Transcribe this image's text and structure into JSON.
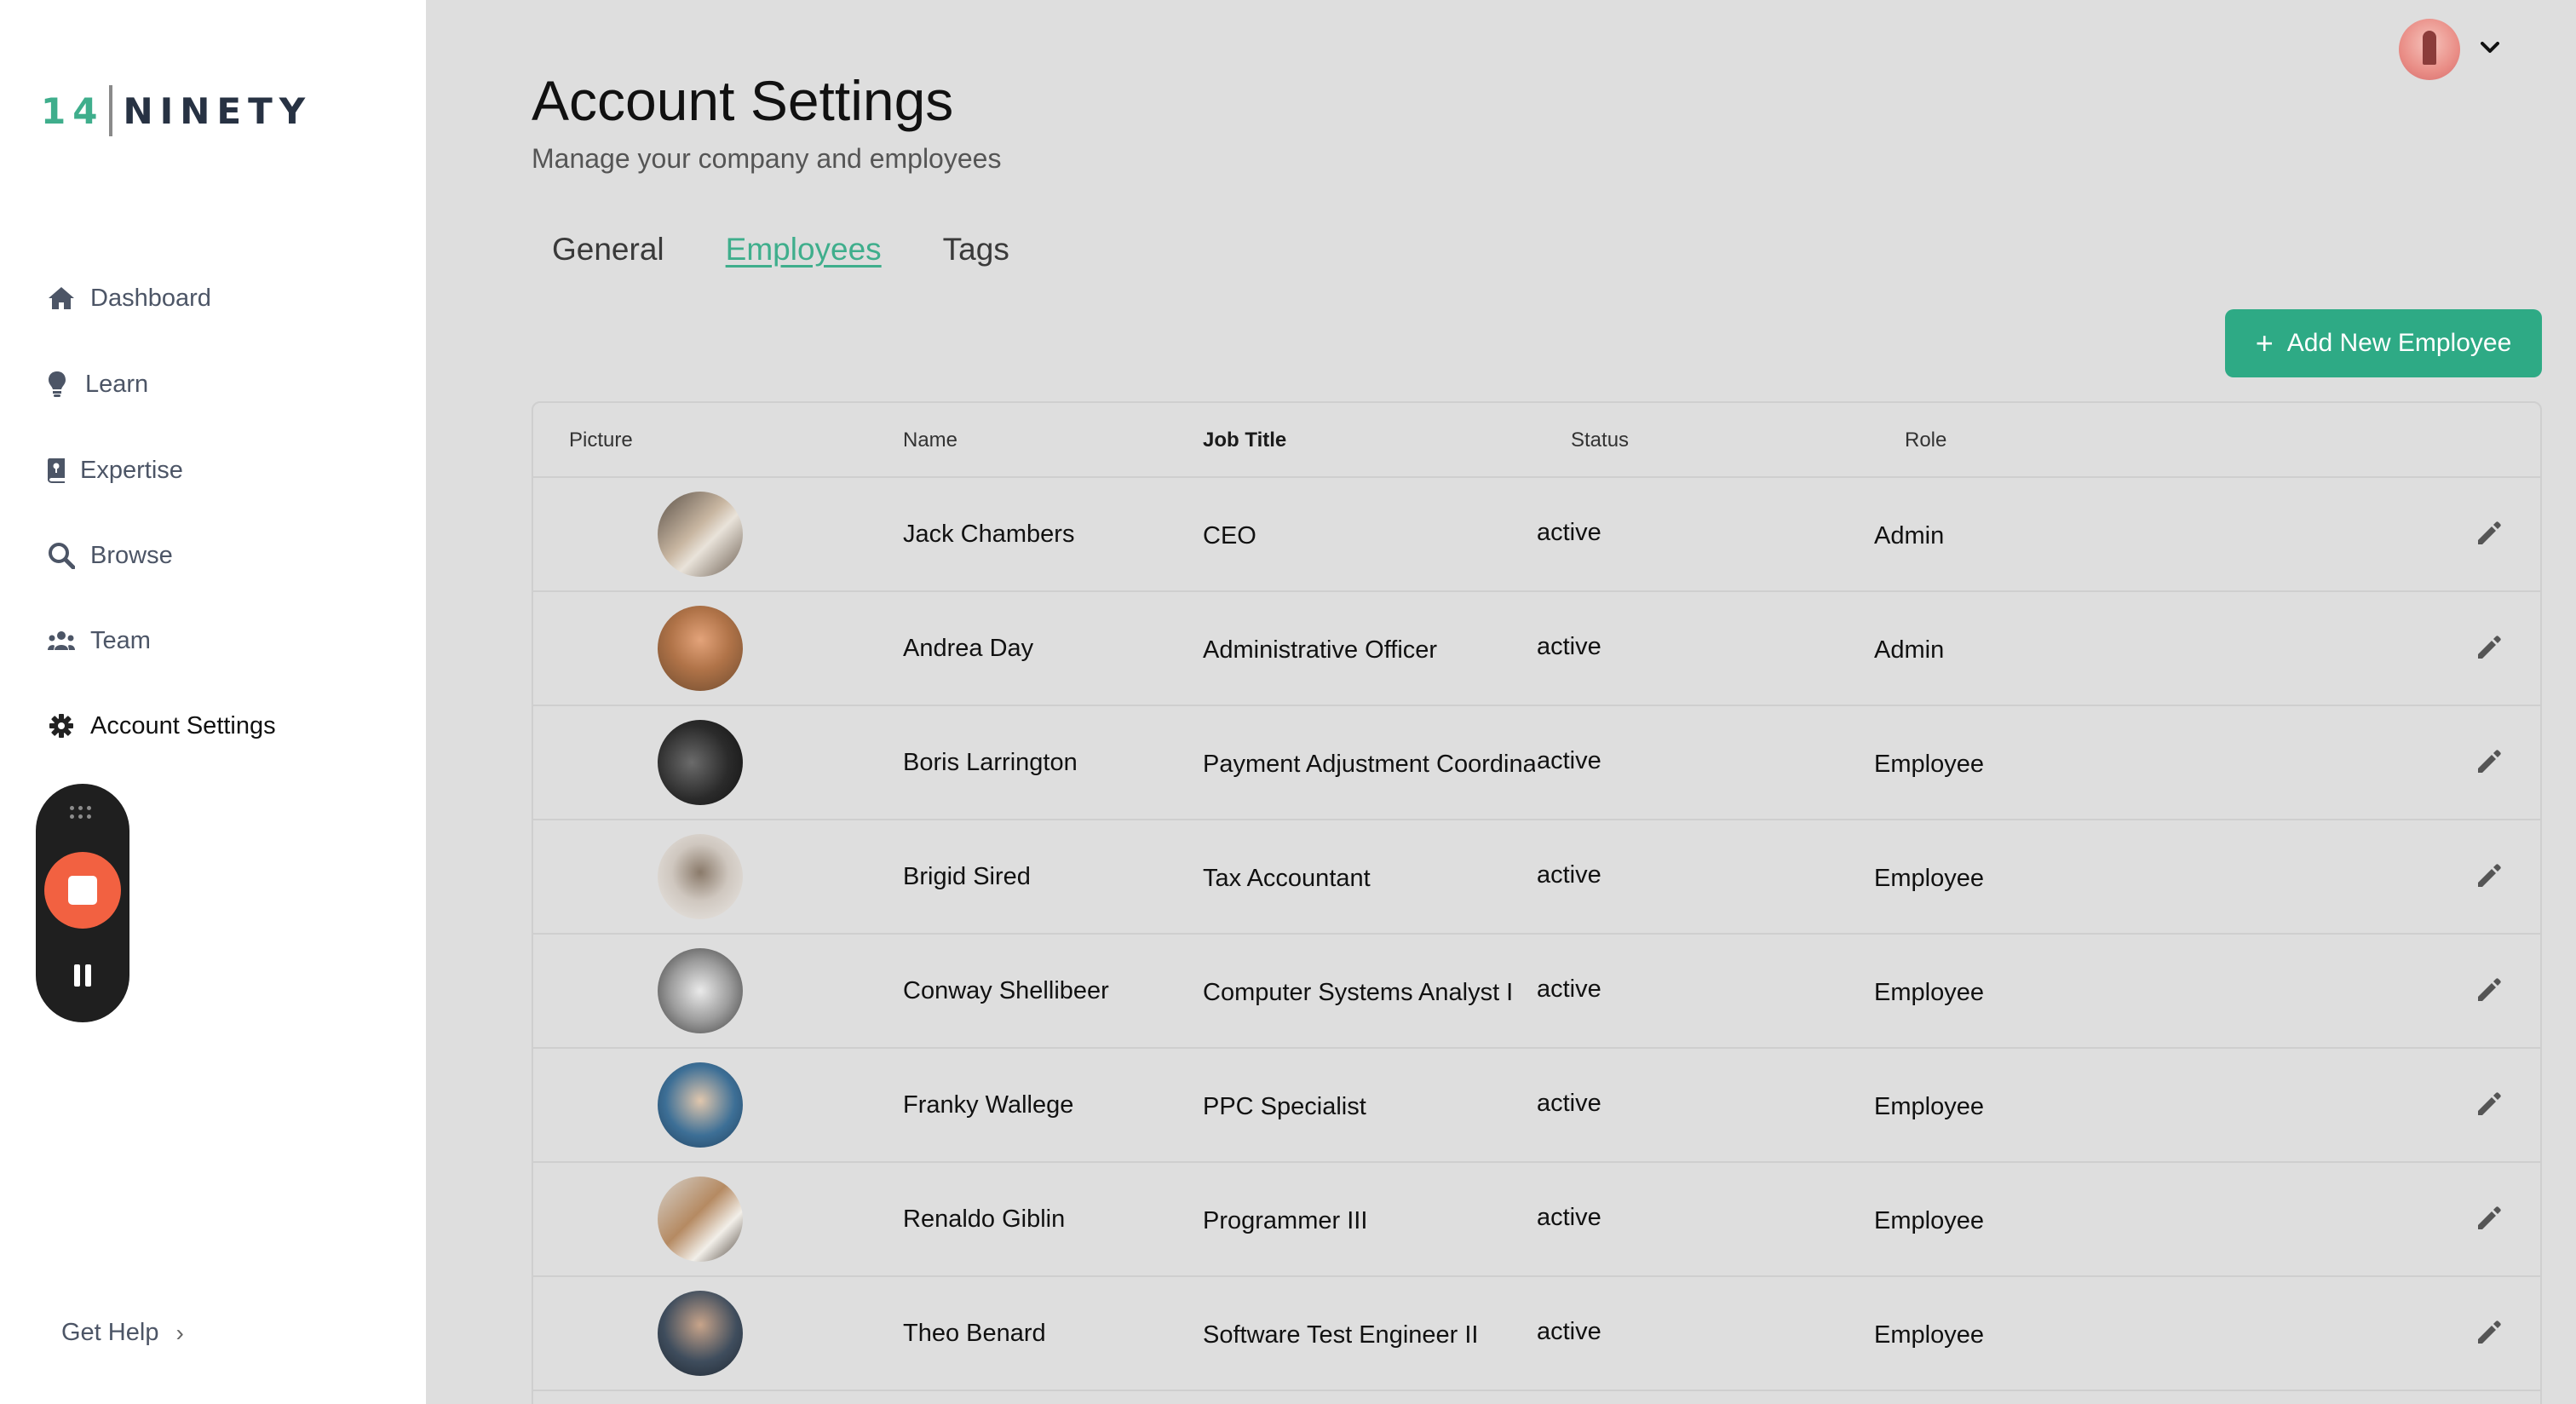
{
  "brand": {
    "num": "14",
    "word": "NINETY"
  },
  "sidebar": {
    "items": [
      {
        "label": "Dashboard",
        "icon": "home-icon"
      },
      {
        "label": "Learn",
        "icon": "lightbulb-icon"
      },
      {
        "label": "Expertise",
        "icon": "book-icon"
      },
      {
        "label": "Browse",
        "icon": "search-icon"
      },
      {
        "label": "Team",
        "icon": "users-icon"
      },
      {
        "label": "Account Settings",
        "icon": "gear-icon",
        "active": true
      }
    ],
    "help": "Get Help"
  },
  "header": {
    "title": "Account Settings",
    "subtitle": "Manage your company and employees"
  },
  "tabs": [
    {
      "label": "General"
    },
    {
      "label": "Employees",
      "active": true
    },
    {
      "label": "Tags"
    }
  ],
  "add_button": {
    "label": "Add New Employee"
  },
  "table": {
    "headers": [
      "Picture",
      "Name",
      "Job Title",
      "Status",
      "Role"
    ],
    "rows": [
      {
        "name": "Jack Chambers",
        "job": "CEO",
        "status": "active",
        "role": "Admin"
      },
      {
        "name": "Andrea Day",
        "job": "Administrative Officer",
        "status": "active",
        "role": "Admin"
      },
      {
        "name": "Boris Larrington",
        "job": "Payment Adjustment Coordinator",
        "status": "active",
        "role": "Employee"
      },
      {
        "name": "Brigid Sired",
        "job": "Tax Accountant",
        "status": "active",
        "role": "Employee"
      },
      {
        "name": "Conway Shellibeer",
        "job": "Computer Systems Analyst I",
        "status": "active",
        "role": "Employee"
      },
      {
        "name": "Franky Wallege",
        "job": "PPC Specialist",
        "status": "active",
        "role": "Employee"
      },
      {
        "name": "Renaldo Giblin",
        "job": "Programmer III",
        "status": "active",
        "role": "Employee"
      },
      {
        "name": "Theo Benard",
        "job": "Software Test Engineer II",
        "status": "active",
        "role": "Employee"
      }
    ]
  },
  "colors": {
    "accent": "#2eaa85",
    "record": "#f26141"
  }
}
